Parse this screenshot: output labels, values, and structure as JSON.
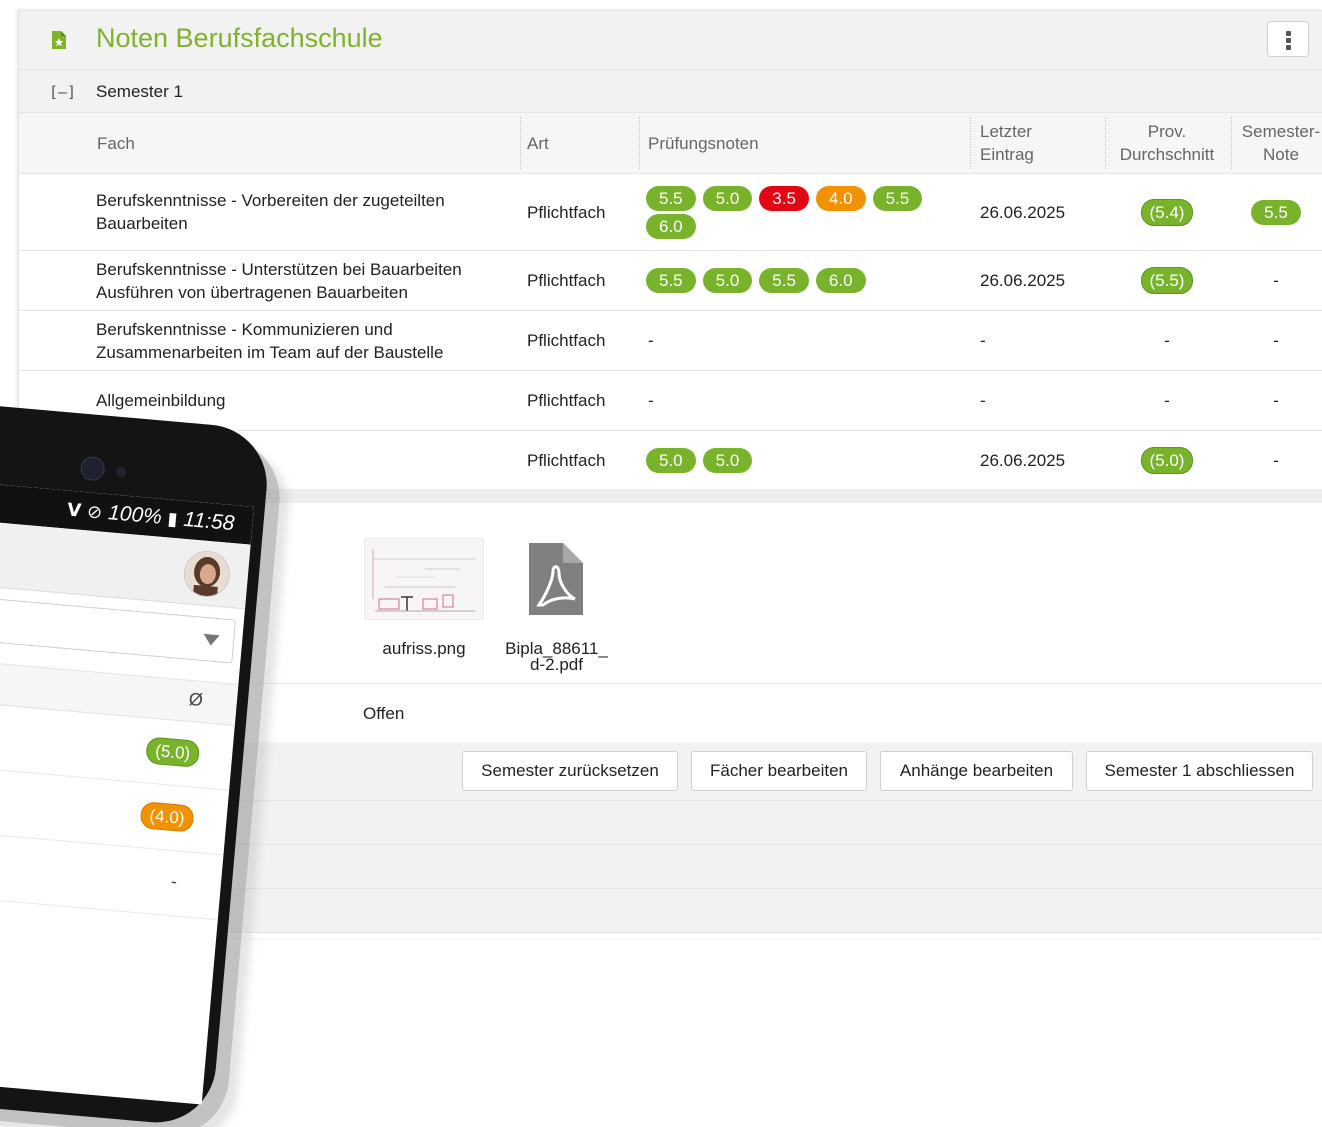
{
  "panel": {
    "title": "Noten Berufsfachschule",
    "semester_label": "Semester 1",
    "collapse_symbol": "[–]"
  },
  "table": {
    "headers": {
      "fach": "Fach",
      "art": "Art",
      "pruefungsnoten": "Prüfungsnoten",
      "letzter_1": "Letzter",
      "letzter_2": "Eintrag",
      "prov_1": "Prov.",
      "prov_2": "Durchschnitt",
      "semester_1": "Semester-",
      "semester_2": "Note"
    },
    "rows": [
      {
        "fach_1": "Berufskenntnisse - Vorbereiten der zugeteilten",
        "fach_2": "Bauarbeiten",
        "art": "Pflichtfach",
        "grades": [
          {
            "value": "5.5",
            "color": "#79b32b"
          },
          {
            "value": "5.0",
            "color": "#79b32b"
          },
          {
            "value": "3.5",
            "color": "#e30613"
          },
          {
            "value": "4.0",
            "color": "#f39200"
          },
          {
            "value": "5.5",
            "color": "#79b32b"
          },
          {
            "value": "6.0",
            "color": "#79b32b"
          }
        ],
        "letzter": "26.06.2025",
        "prov": "(5.4)",
        "semester": "5.5"
      },
      {
        "fach_1": "Berufskenntnisse - Unterstützen bei Bauarbeiten",
        "fach_2": "Ausführen von übertragenen Bauarbeiten",
        "art": "Pflichtfach",
        "grades": [
          {
            "value": "5.5",
            "color": "#79b32b"
          },
          {
            "value": "5.0",
            "color": "#79b32b"
          },
          {
            "value": "5.5",
            "color": "#79b32b"
          },
          {
            "value": "6.0",
            "color": "#79b32b"
          }
        ],
        "letzter": "26.06.2025",
        "prov": "(5.5)",
        "semester": "-"
      },
      {
        "fach_1": "Berufskenntnisse - Kommunizieren und",
        "fach_2": "Zusammenarbeiten im Team auf der Baustelle",
        "art": "Pflichtfach",
        "grades_empty": "-",
        "letzter": "-",
        "prov": "-",
        "semester": "-"
      },
      {
        "fach_1": "Allgemeinbildung",
        "fach_2": "",
        "art": "Pflichtfach",
        "grades_empty": "-",
        "letzter": "-",
        "prov": "-",
        "semester": "-"
      },
      {
        "fach_1": "",
        "fach_2": "",
        "art": "Pflichtfach",
        "grades": [
          {
            "value": "5.0",
            "color": "#79b32b"
          },
          {
            "value": "5.0",
            "color": "#79b32b"
          }
        ],
        "letzter": "26.06.2025",
        "prov": "(5.0)",
        "semester": "-"
      }
    ]
  },
  "attachments": [
    {
      "name": "aufriss.png",
      "icon": "image-thumbnail"
    },
    {
      "name_1": "Bipla_88611_",
      "name_2": "d-2.pdf",
      "icon": "pdf-file-icon"
    }
  ],
  "status": "Offen",
  "buttons": {
    "reset": "Semester zurücksetzen",
    "faecher": "Fächer bearbeiten",
    "anhaenge": "Anhänge bearbeiten",
    "abschliessen": "Semester 1 abschliessen"
  },
  "phone": {
    "status_icons": "wifi, do-not-disturb, battery",
    "battery": "100%",
    "time": "11:58",
    "column_header": "Ø",
    "rows": [
      {
        "value": "(5.0)",
        "color": "#79b32b"
      },
      {
        "value": "(4.0)",
        "color": "#f39200"
      },
      {
        "value": "-"
      }
    ]
  },
  "colors": {
    "accent_green": "#7fb32a",
    "grade_red": "#e30613",
    "grade_orange": "#f39200"
  }
}
